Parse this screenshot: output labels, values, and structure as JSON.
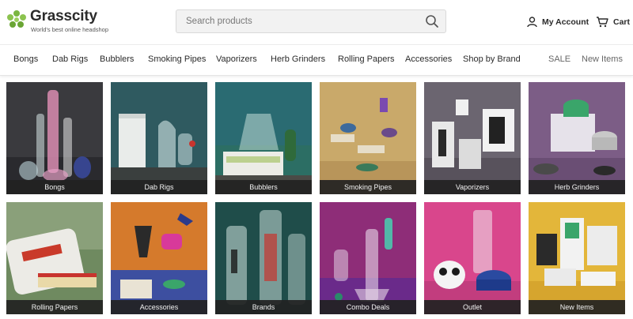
{
  "header": {
    "brand_name": "Grasscity",
    "brand_tagline": "World's best online headshop",
    "search_placeholder": "Search products",
    "account_label": "My Account",
    "cart_label": "Cart",
    "icons": [
      "leaf-logo-icon",
      "search-icon",
      "user-icon",
      "cart-icon"
    ],
    "brand_color": "#7bb640"
  },
  "nav": {
    "items": [
      "Bongs",
      "Dab Rigs",
      "Bubblers",
      "Smoking Pipes",
      "Vaporizers",
      "Herb Grinders",
      "Rolling Papers",
      "Accessories",
      "Shop by Brand"
    ],
    "sale_label": "SALE",
    "new_items_label": "New Items"
  },
  "categories": [
    {
      "label": "Bongs",
      "bg": "#3a3a3e"
    },
    {
      "label": "Dab Rigs",
      "bg": "#2f5a60"
    },
    {
      "label": "Bubblers",
      "bg": "#2c6e64"
    },
    {
      "label": "Smoking Pipes",
      "bg": "#c9a96a"
    },
    {
      "label": "Vaporizers",
      "bg": "#6b6570"
    },
    {
      "label": "Herb Grinders",
      "bg": "#7c5d86"
    },
    {
      "label": "Rolling Papers",
      "bg": "#6f8a60"
    },
    {
      "label": "Accessories",
      "bg": "#d57a2c"
    },
    {
      "label": "Brands",
      "bg": "#1f4d4a"
    },
    {
      "label": "Combo Deals",
      "bg": "#8e2d78"
    },
    {
      "label": "Outlet",
      "bg": "#d9468c"
    },
    {
      "label": "New Items",
      "bg": "#e3b63a"
    }
  ]
}
